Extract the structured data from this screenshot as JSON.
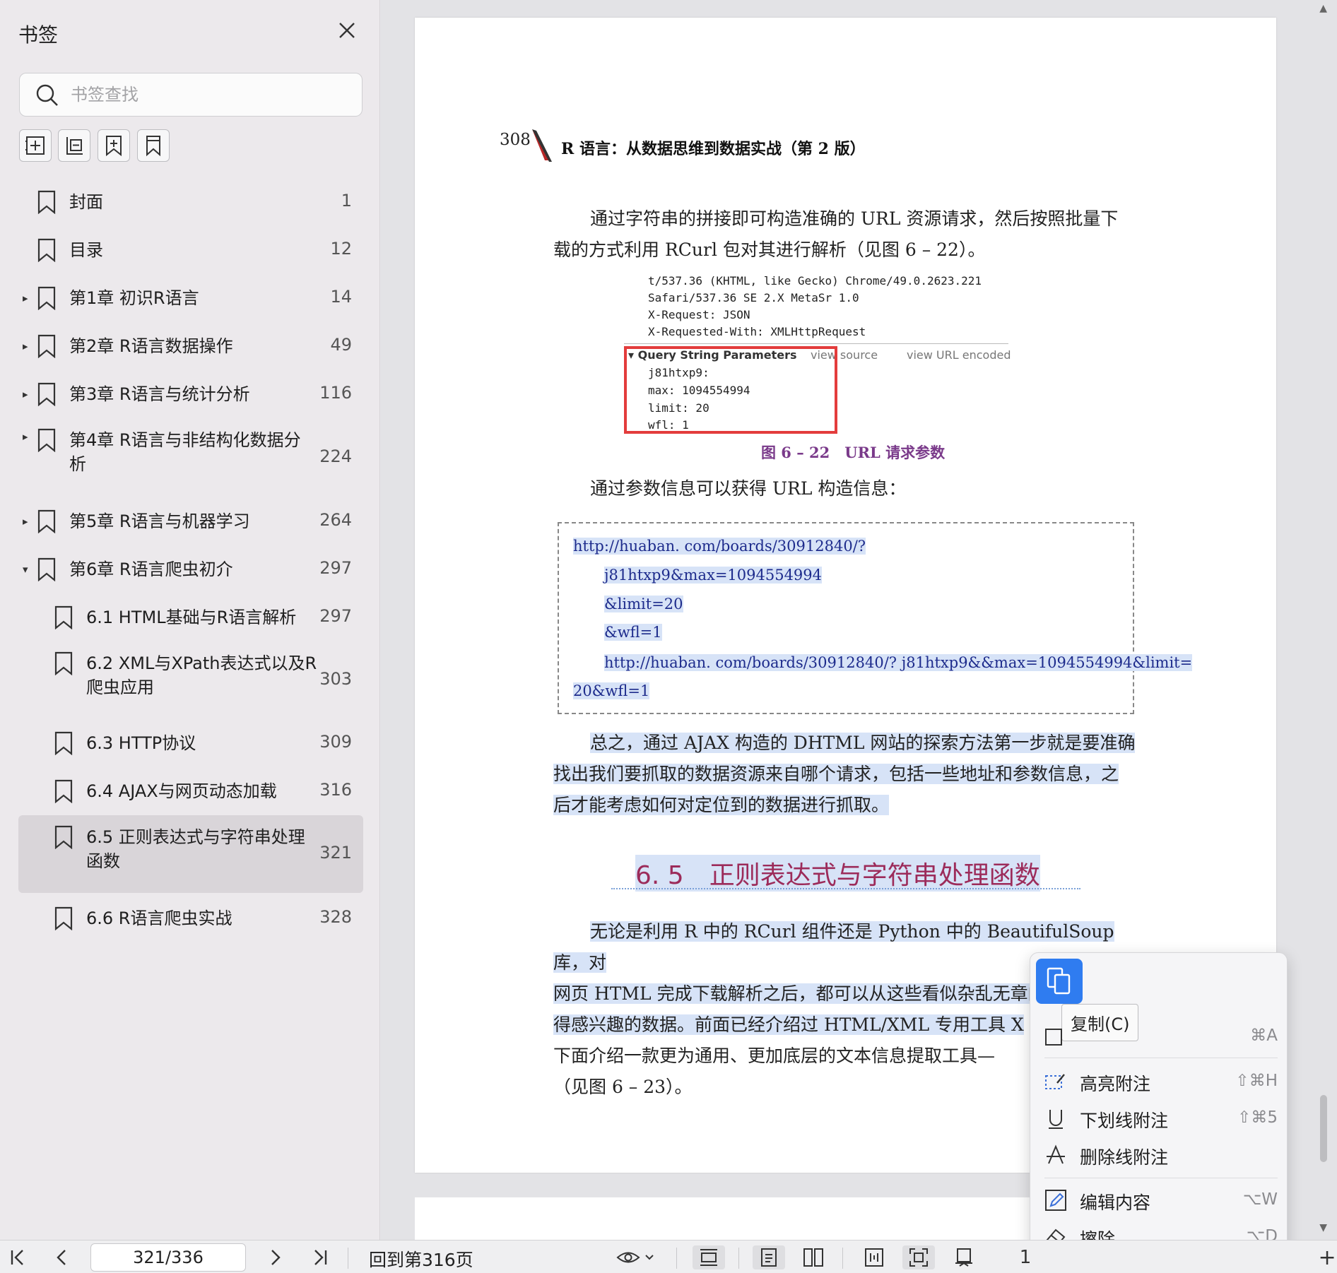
{
  "sidebar": {
    "title": "书签",
    "search_placeholder": "书签查找",
    "items": [
      {
        "label": "封面",
        "page": "1"
      },
      {
        "label": "目录",
        "page": "12"
      },
      {
        "label": "第1章 初识R语言",
        "page": "14"
      },
      {
        "label": "第2章 R语言数据操作",
        "page": "49"
      },
      {
        "label": "第3章 R语言与统计分析",
        "page": "116"
      },
      {
        "label": "第4章 R语言与非结构化数据分",
        "label2": "析",
        "page": "224"
      },
      {
        "label": "第5章 R语言与机器学习",
        "page": "264"
      },
      {
        "label": "第6章 R语言爬虫初介",
        "page": "297"
      },
      {
        "label": "6.1 HTML基础与R语言解析",
        "page": "297"
      },
      {
        "label": "6.2 XML与XPath表达式以及R",
        "label2": "爬虫应用",
        "page": "303"
      },
      {
        "label": "6.3 HTTP协议",
        "page": "309"
      },
      {
        "label": "6.4 AJAX与网页动态加载",
        "page": "316"
      },
      {
        "label": "6.5 正则表达式与字符串处理",
        "label2": "函数",
        "page": "321"
      },
      {
        "label": "6.6 R语言爬虫实战",
        "page": "328"
      }
    ]
  },
  "page": {
    "header_num": "308",
    "header_title": "R 语言：从数据思维到数据实战（第 2 版）",
    "p1_line1": "通过字符串的拼接即可构造准确的 URL 资源请求，然后按照批量下",
    "p1_line2": "载的方式利用 RCurl 包对其进行解析（见图 6 – 22）。",
    "figure": {
      "line1": "t/537.36 (KHTML, like Gecko) Chrome/49.0.2623.221",
      "line2": "Safari/537.36 SE 2.X MetaSr 1.0",
      "line3": "X-Request: JSON",
      "line4": "X-Requested-With: XMLHttpRequest",
      "qsp": "▾ Query String Parameters",
      "view_source": "view source",
      "view_url": "view URL encoded",
      "param1": "j81htxp9:",
      "param2": "max: 1094554994",
      "param3": "limit: 20",
      "param4": "wfl: 1",
      "caption": "图 6 – 22　URL 请求参数"
    },
    "p2": "通过参数信息可以获得 URL 构造信息：",
    "code": {
      "c1": "http://huaban. com/boards/30912840/?",
      "c2": "j81htxp9&max=1094554994",
      "c3": "&limit=20",
      "c4": "&wfl=1",
      "c5": "http://huaban. com/boards/30912840/? j81htxp9&&max=1094554994&limit=",
      "c6": "20&wfl=1"
    },
    "p3_line1": "总之，通过 AJAX 构造的 DHTML 网站的探索方法第一步就是要准确",
    "p3_line2": "找出我们要抓取的数据资源来自哪个请求，包括一些地址和参数信息，之",
    "p3_line3": "后才能考虑如何对定位到的数据进行抓取。",
    "section_title": "6. 5　正则表达式与字符串处理函数",
    "p4_line1": "无论是利用 R 中的 RCurl 组件还是 Python 中的 BeautifulSoup 库，对",
    "p4_line2": "网页 HTML 完成下载解析之后，都可以从这些看似杂乱无章的文本中获",
    "p4_line3": "得感兴趣的数据。前面已经介绍过 HTML/XML 专用工具 X",
    "p4_line4": "下面介绍一款更为通用、更加底层的文本信息提取工具—",
    "p4_line5": "（见图 6 – 23）。"
  },
  "context_menu": {
    "copy_tooltip": "复制(C)",
    "select_all_shortcut": "⌘A",
    "items": [
      {
        "label": "高亮附注",
        "shortcut": "⇧⌘H"
      },
      {
        "label": "下划线附注",
        "shortcut": "⇧⌘5"
      },
      {
        "label": "删除线附注",
        "shortcut": ""
      },
      {
        "label": "编辑内容",
        "shortcut": "⌥W"
      },
      {
        "label": "擦除",
        "shortcut": "⌥D"
      }
    ]
  },
  "bottom": {
    "page_indicator": "321/336",
    "back_link": "回到第316页",
    "partial_number": "1"
  }
}
